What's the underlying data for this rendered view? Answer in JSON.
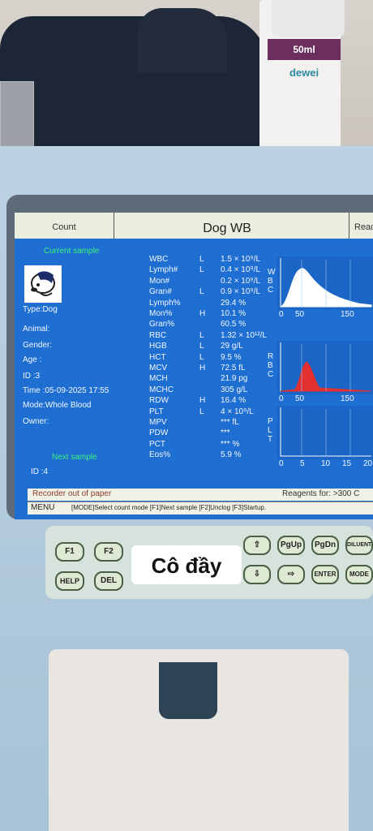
{
  "bottle": {
    "volume": "50ml",
    "brand": "dewei"
  },
  "screen": {
    "header": {
      "count": "Count",
      "mode": "Dog WB",
      "read": "Read"
    },
    "current_sample": "Current sample",
    "patient": [
      {
        "label": "Type:Dog"
      },
      {
        "label": "Animal:"
      },
      {
        "label": "Gender:"
      },
      {
        "label": "Age  :"
      },
      {
        "label": "ID    :3"
      },
      {
        "label": "Time :05-09-2025 17:55"
      },
      {
        "label": "Mode:Whole Blood"
      },
      {
        "label": "Owner:"
      }
    ],
    "next_sample": "Next sample",
    "next_id": "ID    :4",
    "params": [
      {
        "name": "WBC",
        "flag": "L",
        "value": "1.5 × 10⁹/L"
      },
      {
        "name": "Lymph#",
        "flag": "L",
        "value": "0.4 × 10⁹/L"
      },
      {
        "name": "Mon#",
        "flag": "",
        "value": "0.2 × 10⁹/L"
      },
      {
        "name": "Gran#",
        "flag": "L",
        "value": "0.9 × 10⁹/L"
      },
      {
        "name": "Lymph%",
        "flag": "",
        "value": "29.4 %"
      },
      {
        "name": "Mon%",
        "flag": "H",
        "value": "10.1 %"
      },
      {
        "name": "Gran%",
        "flag": "",
        "value": "60.5 %"
      },
      {
        "name": "RBC",
        "flag": "L",
        "value": "1.32 × 10¹²/L"
      },
      {
        "name": "HGB",
        "flag": "L",
        "value": "29 g/L"
      },
      {
        "name": "HCT",
        "flag": "L",
        "value": "9.5 %"
      },
      {
        "name": "MCV",
        "flag": "H",
        "value": "72.5 fL"
      },
      {
        "name": "MCH",
        "flag": "",
        "value": "21.9 pg"
      },
      {
        "name": "MCHC",
        "flag": "",
        "value": "305 g/L"
      },
      {
        "name": "RDW",
        "flag": "H",
        "value": "16.4 %"
      },
      {
        "name": "PLT",
        "flag": "L",
        "value": "4 × 10⁹/L"
      },
      {
        "name": "MPV",
        "flag": "",
        "value": "*** fL"
      },
      {
        "name": "PDW",
        "flag": "",
        "value": "***"
      },
      {
        "name": "PCT",
        "flag": "",
        "value": "*** %"
      },
      {
        "name": "Eos%",
        "flag": "",
        "value": "5.9 %"
      }
    ],
    "histograms": [
      {
        "label": "WBC",
        "ticks": [
          "0",
          "50",
          "150"
        ],
        "color": "#ffffff"
      },
      {
        "label": "RBC",
        "ticks": [
          "0",
          "50",
          "150"
        ],
        "color": "#e23030"
      },
      {
        "label": "PLT",
        "ticks": [
          "0",
          "5",
          "10",
          "15",
          "20"
        ],
        "color": "#ffffff"
      }
    ],
    "status_left": "Recorder out of paper",
    "status_right": "Reagents for: >300 C",
    "menu_label": "MENU",
    "menu_hint": "[MODE]Select count mode [F1]Next sample [F2]Unclog [F3]Startup."
  },
  "keys": {
    "f1": "F1",
    "f2": "F2",
    "help": "HELP",
    "del": "DEL",
    "pgup": "PgUp",
    "pgdn": "PgDn",
    "diluent": "DILUENT",
    "enter": "ENTER",
    "mode": "MODE",
    "up": "⇧",
    "down": "⇩",
    "right": "⇨"
  },
  "caption": "Cô đầy"
}
